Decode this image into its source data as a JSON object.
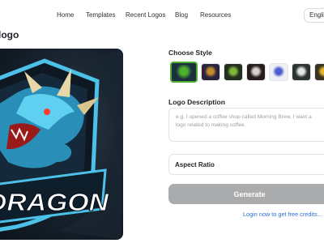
{
  "nav": {
    "items": [
      {
        "label": "Home"
      },
      {
        "label": "Templates"
      },
      {
        "label": "Recent Logos"
      },
      {
        "label": "Blog"
      },
      {
        "label": "Resources"
      }
    ],
    "language": "English"
  },
  "page": {
    "title": "logo"
  },
  "preview": {
    "logo_text": "DRAGON"
  },
  "style_section": {
    "label": "Choose Style",
    "thumbs": [
      {
        "name": "esports-1",
        "color": "#1b2f3e",
        "accent": "#4caf2f",
        "selected": true
      },
      {
        "name": "esports-2",
        "color": "#2a2340",
        "accent": "#c48a2c"
      },
      {
        "name": "esports-3",
        "color": "#22301e",
        "accent": "#7fb53a"
      },
      {
        "name": "esports-4",
        "color": "#2a1c1c",
        "accent": "#d6d2cc"
      },
      {
        "name": "esports-5",
        "color": "#eef0f6",
        "accent": "#4d5bd0"
      },
      {
        "name": "esports-6",
        "color": "#2b3430",
        "accent": "#e6e6e6"
      },
      {
        "name": "esports-7",
        "color": "#3a3320",
        "accent": "#e2b62f"
      }
    ]
  },
  "description": {
    "label": "Logo Description",
    "placeholder": "e.g. I opened a coffee shop called Morning Brew, I want a logo related to making coffee."
  },
  "aspect": {
    "label": "Aspect Ratio"
  },
  "actions": {
    "generate_label": "Generate",
    "login_text": "Login now to get free credits..."
  }
}
